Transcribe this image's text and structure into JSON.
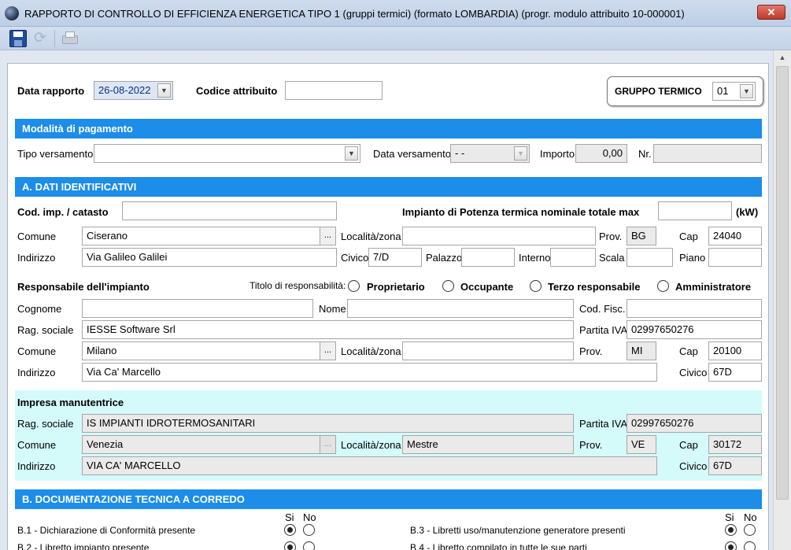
{
  "window": {
    "title": "RAPPORTO DI CONTROLLO DI EFFICIENZA ENERGETICA TIPO 1 (gruppi termici) (formato LOMBARDIA)  (progr. modulo attribuito 10-000001)",
    "close_label": "✕"
  },
  "toolbar": {
    "save_icon": "save-icon",
    "refresh_icon": "refresh-icon",
    "print_icon": "print-icon"
  },
  "header": {
    "data_rapporto_label": "Data rapporto",
    "data_rapporto_value": "26-08-2022",
    "codice_attribuito_label": "Codice attribuito",
    "codice_attribuito_value": "",
    "gruppo_termico_label": "GRUPPO TERMICO",
    "gruppo_termico_value": "01"
  },
  "pagamento": {
    "section_title": "Modalità di pagamento",
    "tipo_versamento_label": "Tipo versamento",
    "tipo_versamento_value": "",
    "data_versamento_label": "Data versamento",
    "data_versamento_value": "- -",
    "importo_label": "Importo",
    "importo_value": "0,00",
    "nr_label": "Nr.",
    "nr_value": ""
  },
  "dati": {
    "section_title": "A. DATI IDENTIFICATIVI",
    "cod_imp_label": "Cod. imp. / catasto",
    "cod_imp_value": "",
    "potenza_label": "Impianto di Potenza termica nominale totale max",
    "potenza_value": "",
    "potenza_unit": "(kW)",
    "comune_label": "Comune",
    "comune_value": "Ciserano",
    "localita_label": "Località/zona",
    "localita_value": "",
    "prov_label": "Prov.",
    "prov_value": "BG",
    "cap_label": "Cap",
    "cap_value": "24040",
    "indirizzo_label": "Indirizzo",
    "indirizzo_value": "Via Galileo Galilei",
    "civico_label": "Civico",
    "civico_value": "7/D",
    "palazzo_label": "Palazzo",
    "palazzo_value": "",
    "interno_label": "Interno",
    "interno_value": "",
    "scala_label": "Scala",
    "scala_value": "",
    "piano_label": "Piano",
    "piano_value": "",
    "dots_label": "..."
  },
  "responsabile": {
    "title": "Responsabile dell'impianto",
    "titolo_label": "Titolo di responsabilità:",
    "options": [
      "Proprietario",
      "Occupante",
      "Terzo responsabile",
      "Amministratore"
    ],
    "cognome_label": "Cognome",
    "cognome_value": "",
    "nome_label": "Nome",
    "nome_value": "",
    "codfisc_label": "Cod. Fisc.",
    "codfisc_value": "",
    "ragsoc_label": "Rag. sociale",
    "ragsoc_value": "IESSE Software Srl",
    "piva_label": "Partita IVA",
    "piva_value": "02997650276",
    "comune_label": "Comune",
    "comune_value": "Milano",
    "localita_label": "Località/zona",
    "localita_value": "",
    "prov_label": "Prov.",
    "prov_value": "MI",
    "cap_label": "Cap",
    "cap_value": "20100",
    "indirizzo_label": "Indirizzo",
    "indirizzo_value": "Via Ca' Marcello",
    "civico_label": "Civico",
    "civico_value": "67D"
  },
  "impresa": {
    "title": "Impresa manutentrice",
    "ragsoc_label": "Rag. sociale",
    "ragsoc_value": "IS IMPIANTI IDROTERMOSANITARI",
    "piva_label": "Partita IVA",
    "piva_value": "02997650276",
    "comune_label": "Comune",
    "comune_value": "Venezia",
    "localita_label": "Località/zona",
    "localita_value": "Mestre",
    "prov_label": "Prov.",
    "prov_value": "VE",
    "cap_label": "Cap",
    "cap_value": "30172",
    "indirizzo_label": "Indirizzo",
    "indirizzo_value": "VIA CA' MARCELLO",
    "civico_label": "Civico",
    "civico_value": "67D"
  },
  "documentazione": {
    "section_title": "B. DOCUMENTAZIONE TECNICA A CORREDO",
    "si_label": "Si",
    "no_label": "No",
    "items": [
      {
        "label": "B.1 - Dichiarazione di Conformità presente"
      },
      {
        "label": "B.2 - Libretto impianto presente"
      },
      {
        "label": "B.3 - Libretti uso/manutenzione generatore presenti"
      },
      {
        "label": "B.4 - Libretto compilato in tutte le sue parti"
      }
    ]
  },
  "colors": {
    "section_blue": "#1c8de8",
    "impresa_bg": "#d4fafa",
    "date_text": "#0b2f7e"
  }
}
